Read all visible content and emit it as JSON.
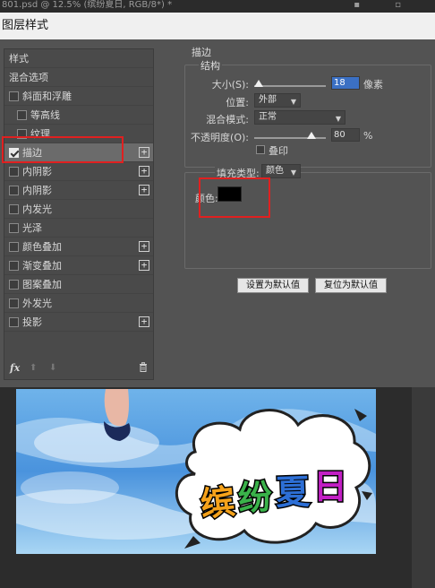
{
  "ps_titlebar": {
    "text": "801.psd @ 12.5% (缤纷夏日, RGB/8*) *"
  },
  "dialog_title": "图层样式",
  "left_panel": {
    "header_styles": "样式",
    "header_blending": "混合选项",
    "items": [
      {
        "label": "斜面和浮雕",
        "checked": false,
        "has_plus": false
      },
      {
        "label": "等高线",
        "checked": false,
        "has_plus": false
      },
      {
        "label": "纹理",
        "checked": false,
        "has_plus": false
      },
      {
        "label": "描边",
        "checked": true,
        "has_plus": true,
        "selected": true
      },
      {
        "label": "内阴影",
        "checked": false,
        "has_plus": true
      },
      {
        "label": "内阴影",
        "checked": false,
        "has_plus": true
      },
      {
        "label": "内发光",
        "checked": false,
        "has_plus": false
      },
      {
        "label": "光泽",
        "checked": false,
        "has_plus": false
      },
      {
        "label": "颜色叠加",
        "checked": false,
        "has_plus": true
      },
      {
        "label": "渐变叠加",
        "checked": false,
        "has_plus": true
      },
      {
        "label": "图案叠加",
        "checked": false,
        "has_plus": false
      },
      {
        "label": "外发光",
        "checked": false,
        "has_plus": false
      },
      {
        "label": "投影",
        "checked": false,
        "has_plus": true
      }
    ],
    "footer": {
      "fx": "fx",
      "up": "⬆",
      "down": "⬇",
      "trash": "🗑"
    }
  },
  "stroke": {
    "section_title": "描边",
    "group_title": "结构",
    "size_label": "大小(S):",
    "size_value": "18",
    "size_unit": "像素",
    "size_slider_fraction": 0.06,
    "position_label": "位置:",
    "position_value": "外部",
    "blend_label": "混合模式:",
    "blend_value": "正常",
    "opacity_label": "不透明度(O):",
    "opacity_value": "80",
    "opacity_unit": "%",
    "opacity_slider_fraction": 0.8,
    "overprint_label": "叠印",
    "fill_type_label": "填充类型:",
    "fill_type_value": "颜色",
    "color_label": "颜色:",
    "color_value": "#000000"
  },
  "buttons": {
    "set_default": "设置为默认值",
    "reset_default": "复位为默认值"
  },
  "artwork": {
    "title_chars": [
      "缤",
      "纷",
      "夏",
      "日"
    ],
    "title_colors": [
      "#f5a21b",
      "#3ab24a",
      "#2d6fd6",
      "#c21fc4"
    ]
  },
  "colors": {
    "highlight_red": "#e02020",
    "dialog_bg": "#535353",
    "selection_blue": "#3b70c4"
  }
}
